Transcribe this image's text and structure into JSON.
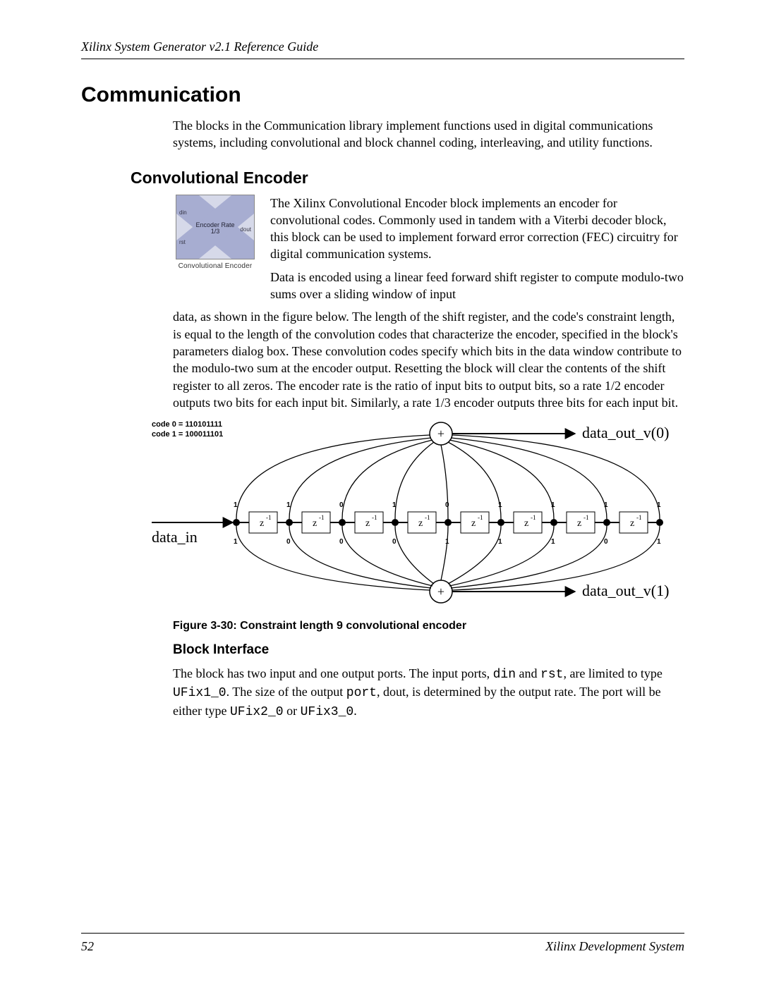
{
  "header": {
    "running": "Xilinx System Generator v2.1 Reference Guide"
  },
  "section": {
    "title": "Communication",
    "intro": "The blocks in the Communication library implement functions used in digital communications systems, including convolutional and block channel coding, interleaving, and utility functions."
  },
  "subsection": {
    "title": "Convolutional Encoder",
    "icon": {
      "din": "din",
      "rst": "rst",
      "dout": "dout",
      "center1": "Encoder Rate",
      "center2": "1/3",
      "caption": "Convolutional Encoder"
    },
    "p1": "The Xilinx Convolutional Encoder block implements an encoder for convolutional codes.  Commonly used in tandem with a Viterbi decoder block, this block can be used to implement forward error correction (FEC) circuitry for digital communication systems.",
    "p2a": "Data is encoded using a linear feed forward shift register to compute modulo-two sums over a sliding window of input ",
    "p2b": "data, as shown in the figure below.  The length of the shift register, and the code's constraint length, is equal to the length of the convolution codes that characterize the encoder, specified in the block's parameters dialog box.  These convolution codes specify which bits in the data window contribute to the modulo-two sum at the encoder output.  Resetting the block will clear the contents of the shift register to all zeros.  The encoder rate is the ratio of input bits to output bits, so a rate 1/2 encoder outputs two bits for each input bit.  Similarly, a rate 1/3 encoder outputs three bits for each input bit."
  },
  "figure": {
    "code0": "code 0 = 110101111",
    "code1": "code 1 = 100011101",
    "data_in": "data_in",
    "out0": "data_out_v(0)",
    "out1": "data_out_v(1)",
    "z": "z",
    "zexp": "-1",
    "caption": "Figure 3-30:   Constraint length 9 convolutional encoder"
  },
  "block_interface": {
    "title": "Block Interface",
    "p_a": "The block has two input and one output ports.  The input ports, ",
    "c_din": "din",
    "p_b": " and ",
    "c_rst": "rst",
    "p_c": ", are limited to type ",
    "c_ufix1": "UFix1_0",
    "p_d": ".  The size of the output ",
    "c_port": "port",
    "p_e": ", dout, is determined by the output rate. The port will be either type ",
    "c_ufix2": "UFix2_0",
    "p_f": " or ",
    "c_ufix3": "UFix3_0",
    "p_g": "."
  },
  "footer": {
    "page": "52",
    "system": "Xilinx Development System"
  },
  "chart_data": {
    "type": "diagram",
    "description": "Constraint length 9 convolutional encoder",
    "constraint_length": 9,
    "shift_registers": 8,
    "input": "data_in",
    "outputs": [
      "data_out_v(0)",
      "data_out_v(1)"
    ],
    "codes": [
      {
        "name": "code 0",
        "value": "110101111",
        "bits": [
          1,
          1,
          0,
          1,
          0,
          1,
          1,
          1,
          1
        ]
      },
      {
        "name": "code 1",
        "value": "100011101",
        "bits": [
          1,
          0,
          0,
          0,
          1,
          1,
          1,
          0,
          1
        ]
      }
    ]
  }
}
